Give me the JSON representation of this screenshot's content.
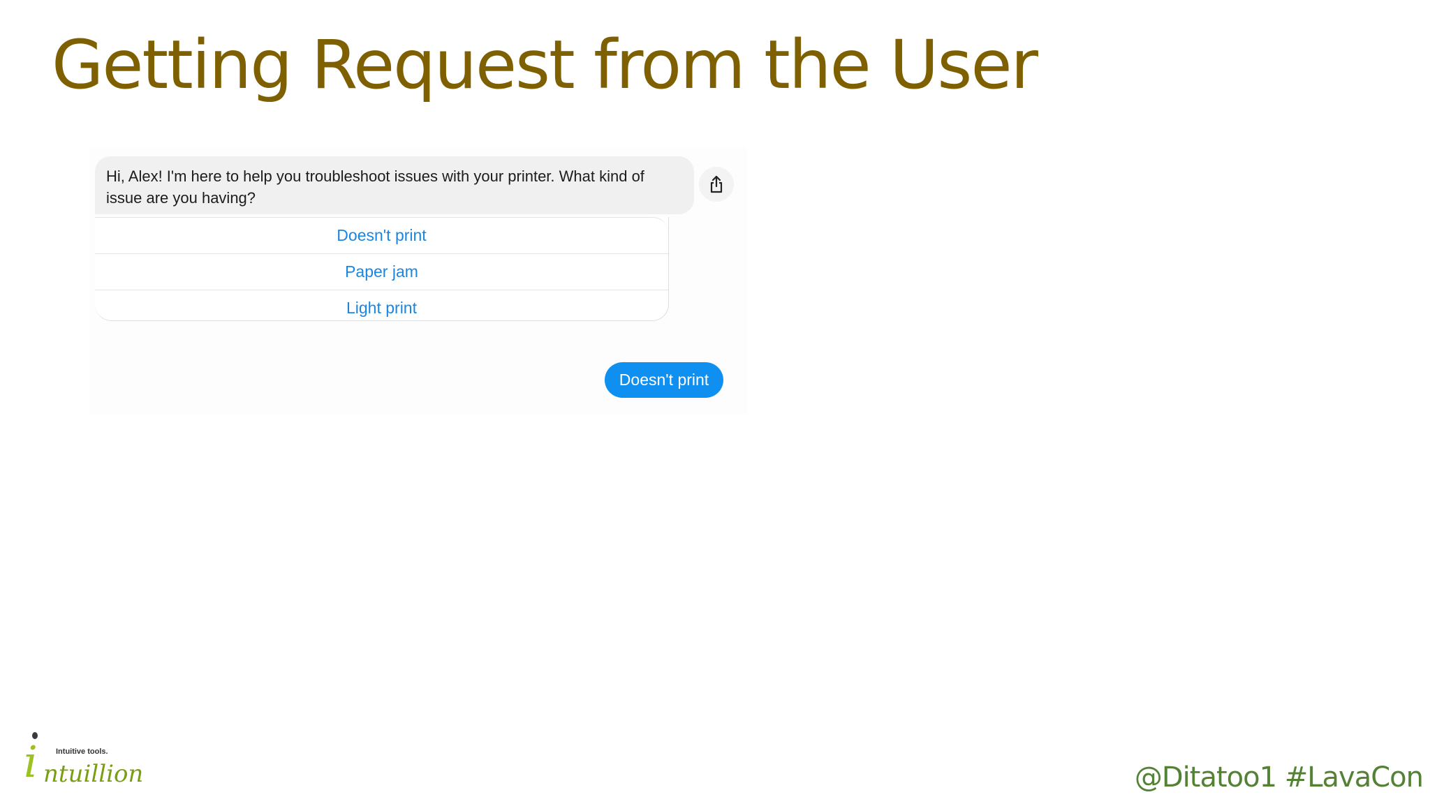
{
  "slide": {
    "title": "Getting Request from the User",
    "footer": "@Ditatoo1 #LavaCon"
  },
  "chat": {
    "bot_message": "Hi, Alex! I'm here to help you troubleshoot issues with your printer. What kind of issue are you having?",
    "share_icon": "share-icon",
    "options": [
      {
        "label": "Doesn't print"
      },
      {
        "label": "Paper jam"
      },
      {
        "label": "Light print"
      }
    ],
    "user_message": "Doesn't print"
  },
  "logo": {
    "letter": "i",
    "name": "ntuillion",
    "tagline": "Intuitive tools."
  },
  "colors": {
    "title": "#7f6000",
    "link": "#1a86e0",
    "user_bubble": "#0f8ff0",
    "footer": "#548235",
    "logo_green": "#9cc21f"
  }
}
